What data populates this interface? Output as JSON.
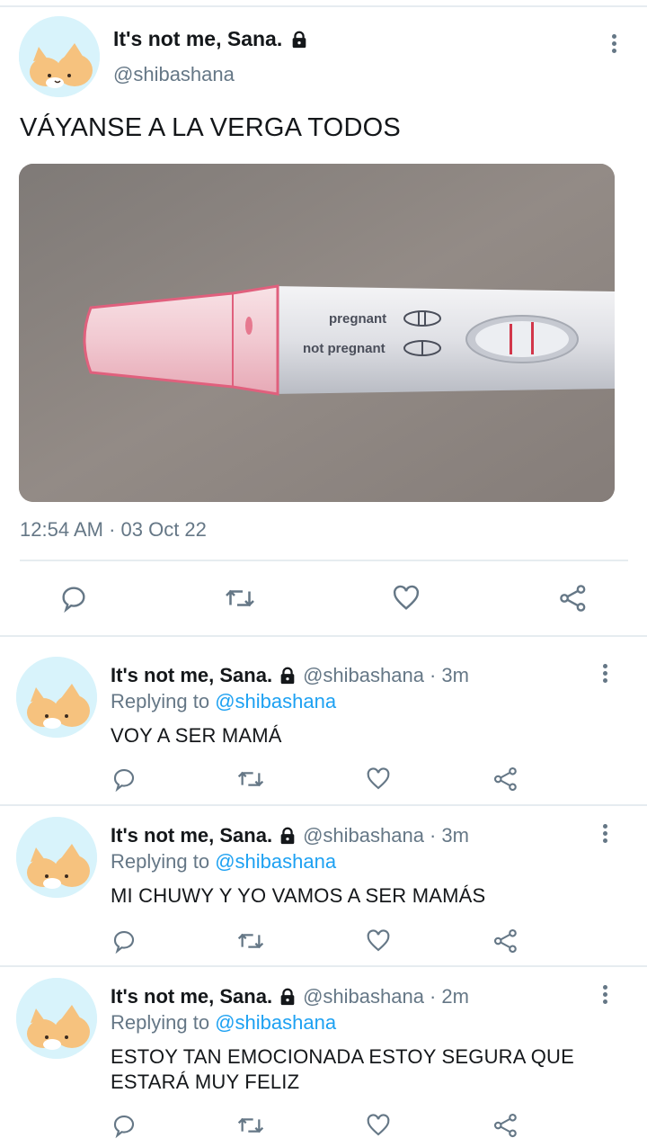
{
  "main_tweet": {
    "name": "It's not me, Sana.",
    "handle": "@shibashana",
    "text": "VÁYANSE A LA VERGA TODOS",
    "timestamp": "12:54 AM · 03 Oct 22",
    "photo_labels": {
      "pregnant": "pregnant",
      "not_pregnant": "not pregnant"
    }
  },
  "replies": [
    {
      "name": "It's not me, Sana.",
      "handle": "@shibashana",
      "time": "· 3m",
      "replying_prefix": "Replying to",
      "replying_to": "@shibashana",
      "text": "VOY A SER MAMÁ"
    },
    {
      "name": "It's not me, Sana.",
      "handle": "@shibashana",
      "time": "· 3m",
      "replying_prefix": "Replying to",
      "replying_to": "@shibashana",
      "text": "MI CHUWY Y YO VAMOS A SER MAMÁS"
    },
    {
      "name": "It's not me, Sana.",
      "handle": "@shibashana",
      "time": "· 2m",
      "replying_prefix": "Replying to",
      "replying_to": "@shibashana",
      "text": "ESTOY TAN EMOCIONADA ESTOY SEGURA QUE ESTARÁ MUY FELIZ"
    }
  ],
  "icons": [
    "lock-icon",
    "more-icon",
    "reply-icon",
    "retweet-icon",
    "like-icon",
    "share-icon"
  ],
  "colors": {
    "text": "#14171a",
    "secondary": "#657786",
    "link": "#1da1f2",
    "divider": "#e6ecf0",
    "avatar_bg": "#d8f3fb"
  }
}
